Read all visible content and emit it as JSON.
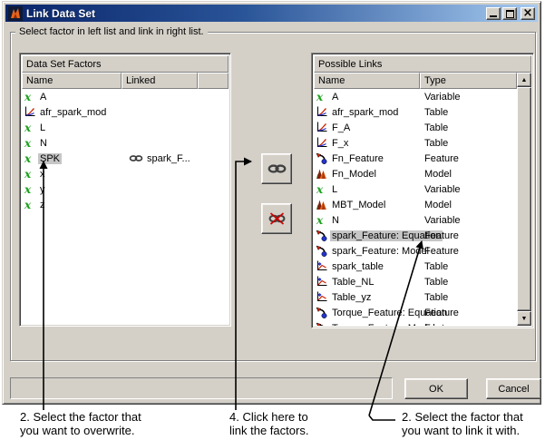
{
  "window": {
    "title": "Link Data Set",
    "icon": "matlab-icon",
    "controls": {
      "minimize": "minimize",
      "maximize": "maximize",
      "close": "close"
    }
  },
  "instruction": "Select factor in left list and link in right list.",
  "left_panel": {
    "title": "Data Set Factors",
    "columns": {
      "name": "Name",
      "linked": "Linked"
    },
    "rows": [
      {
        "icon": "variable",
        "name": "A"
      },
      {
        "icon": "plot",
        "name": "afr_spark_mod"
      },
      {
        "icon": "variable",
        "name": "L"
      },
      {
        "icon": "variable",
        "name": "N"
      },
      {
        "icon": "variable",
        "name": "SPK",
        "selected": true,
        "linked": "spark_F..."
      },
      {
        "icon": "variable",
        "name": "x"
      },
      {
        "icon": "variable",
        "name": "y"
      },
      {
        "icon": "variable",
        "name": "z"
      }
    ]
  },
  "right_panel": {
    "title": "Possible Links",
    "columns": {
      "name": "Name",
      "type": "Type"
    },
    "scrollbar": {
      "up": "▲",
      "down": "▼"
    },
    "rows": [
      {
        "icon": "variable",
        "name": "A",
        "type": "Variable"
      },
      {
        "icon": "plot",
        "name": "afr_spark_mod",
        "type": "Table"
      },
      {
        "icon": "plot",
        "name": "F_A",
        "type": "Table"
      },
      {
        "icon": "plot",
        "name": "F_x",
        "type": "Table"
      },
      {
        "icon": "feature",
        "name": "Fn_Feature",
        "type": "Feature"
      },
      {
        "icon": "model",
        "name": "Fn_Model",
        "type": "Model"
      },
      {
        "icon": "variable",
        "name": "L",
        "type": "Variable"
      },
      {
        "icon": "model",
        "name": "MBT_Model",
        "type": "Model"
      },
      {
        "icon": "variable",
        "name": "N",
        "type": "Variable"
      },
      {
        "icon": "feature",
        "name": "spark_Feature: Equation",
        "type": "Feature",
        "selected": true
      },
      {
        "icon": "feature",
        "name": "spark_Feature: Model",
        "type": "Feature"
      },
      {
        "icon": "table",
        "name": "spark_table",
        "type": "Table"
      },
      {
        "icon": "table",
        "name": "Table_NL",
        "type": "Table"
      },
      {
        "icon": "table",
        "name": "Table_yz",
        "type": "Table"
      },
      {
        "icon": "feature",
        "name": "Torque_Feature: Equation",
        "type": "Feature"
      },
      {
        "icon": "feature",
        "name": "Torque_Feature: Model",
        "type": "Feature"
      }
    ]
  },
  "middle_buttons": {
    "link": "chain-link-icon",
    "unlink": "chain-broken-icon"
  },
  "buttons": {
    "ok": "OK",
    "cancel": "Cancel"
  },
  "annotations": {
    "overwrite": {
      "lines": [
        "2. Select the factor that",
        "you want to overwrite."
      ]
    },
    "click_link": {
      "lines": [
        "4. Click here to",
        "link the factors."
      ]
    },
    "link_with": {
      "lines": [
        "2. Select the factor that",
        "you want to link it with."
      ]
    }
  },
  "colors": {
    "face": "#d4d0c8",
    "titlebar_left": "#0a246a",
    "titlebar_right": "#a6caf0",
    "selection": "#c6c6c6",
    "variable_green": "#1ea11e",
    "list_bg": "#ffffff"
  }
}
